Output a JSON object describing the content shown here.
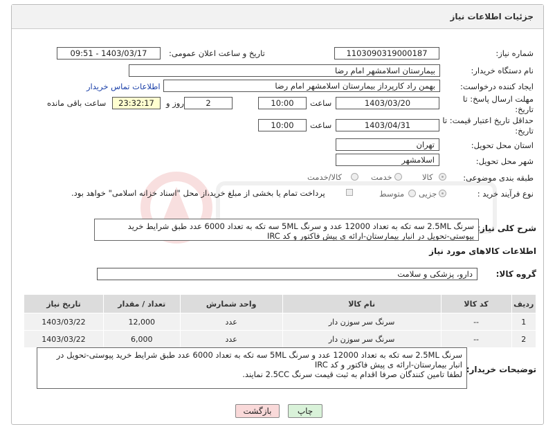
{
  "header": {
    "title": "جزئیات اطلاعات نیاز"
  },
  "fields": {
    "need_number_label": "شماره نیاز:",
    "need_number": "1103090319000187",
    "announce_label": "تاریخ و ساعت اعلان عمومی:",
    "announce_value": "1403/03/17 - 09:51",
    "buyer_org_label": "نام دستگاه خریدار:",
    "buyer_org": "بیمارستان اسلامشهر   امام رضا",
    "requester_label": "ایجاد کننده درخواست:",
    "requester": "بهمن راد کارپرداز بیمارستان اسلامشهر   امام رضا",
    "contact_link": "اطلاعات تماس خریدار",
    "deadline_label_1": "مهلت ارسال پاسخ: تا",
    "deadline_label_2": "تاریخ:",
    "deadline_date": "1403/03/20",
    "time_label": "ساعت",
    "deadline_time": "10:00",
    "days_value": "2",
    "days_label": "روز و",
    "remaining_time": "23:32:17",
    "remaining_label": "ساعت باقی مانده",
    "validity_label_1": "حداقل تاریخ اعتبار قیمت: تا",
    "validity_label_2": "تاریخ:",
    "validity_date": "1403/04/31",
    "validity_time": "10:00",
    "province_label": "استان محل تحویل:",
    "province": "تهران",
    "city_label": "شهر محل تحویل:",
    "city": "اسلامشهر",
    "category_label": "طبقه بندی موضوعی:",
    "category_options": [
      "کالا",
      "خدمت",
      "کالا/خدمت"
    ],
    "purchase_type_label": "نوع فرآیند خرید :",
    "purchase_options": [
      "جزیی",
      "متوسط"
    ],
    "payment_note": "پرداخت تمام یا بخشی از مبلغ خرید،از محل \"اسناد خزانه اسلامی\" خواهد بود.",
    "summary_label": "شرح کلی نیاز:",
    "summary_line1": "سرنگ 2.5ML سه تکه به تعداد 12000 عدد و سرنگ 5ML سه تکه به تعداد 6000 عدد طبق شرایط خرید",
    "summary_line2": "پیوستی-تحویل در انبار بیمارستان-ارائه ی پیش فاکتور و کد IRC",
    "goods_info_title": "اطلاعات کالاهای مورد نیاز",
    "goods_group_label": "گروه کالا:",
    "goods_group": "دارو، پزشکی و سلامت",
    "buyer_notes_label": "توضیحات خریدار:",
    "buyer_notes_line1": "سرنگ 2.5ML سه تکه به تعداد 12000 عدد و سرنگ 5ML سه تکه به تعداد 6000 عدد طبق شرایط خرید پیوستی-تحویل در",
    "buyer_notes_line2": "انبار بیمارستان-ارائه ی پیش فاکتور و کد IRC",
    "buyer_notes_line3": "لطفا تامین کنندگان صرفا اقدام به ثبت قیمت سرنگ 2.5CC نمایند."
  },
  "table": {
    "headers": [
      "ردیف",
      "کد کالا",
      "نام کالا",
      "واحد شمارش",
      "تعداد / مقدار",
      "تاریخ نیاز"
    ],
    "rows": [
      [
        "1",
        "--",
        "سرنگ سر سوزن دار",
        "عدد",
        "12,000",
        "1403/03/22"
      ],
      [
        "2",
        "--",
        "سرنگ سر سوزن دار",
        "عدد",
        "6,000",
        "1403/03/22"
      ]
    ]
  },
  "buttons": {
    "print": "چاپ",
    "back": "بازگشت"
  },
  "colors": {
    "header_bg": "#f2f2f2",
    "link": "#1a3fa8",
    "print_bg": "#d9f2d9",
    "back_bg": "#f9d9d9"
  }
}
